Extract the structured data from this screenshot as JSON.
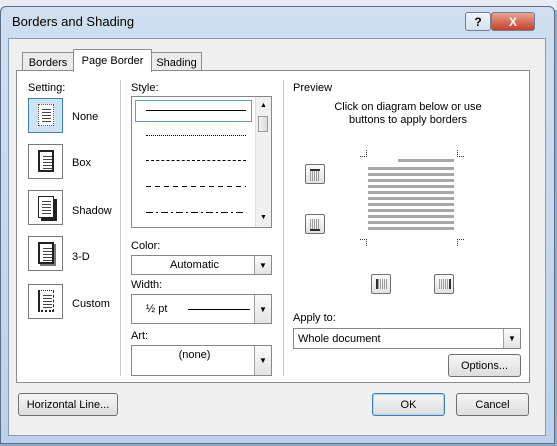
{
  "window": {
    "title": "Borders and Shading",
    "help_glyph": "?",
    "close_glyph": "X"
  },
  "tabs": [
    {
      "label": "Borders",
      "active": false
    },
    {
      "label": "Page Border",
      "active": true
    },
    {
      "label": "Shading",
      "active": false
    }
  ],
  "setting": {
    "label": "Setting:",
    "options": [
      {
        "label": "None",
        "icon": "setting-none-icon",
        "selected": true
      },
      {
        "label": "Box",
        "icon": "setting-box-icon",
        "selected": false
      },
      {
        "label": "Shadow",
        "icon": "setting-shadow-icon",
        "selected": false
      },
      {
        "label": "3-D",
        "icon": "setting-3d-icon",
        "selected": false
      },
      {
        "label": "Custom",
        "icon": "setting-custom-icon",
        "selected": false
      }
    ]
  },
  "style": {
    "label": "Style:",
    "items": [
      "solid",
      "dotted",
      "dashed-small",
      "dashed-large",
      "dash-dot"
    ],
    "selected": "solid"
  },
  "color": {
    "label": "Color:",
    "value": "Automatic"
  },
  "width": {
    "label": "Width:",
    "value": "½ pt"
  },
  "art": {
    "label": "Art:",
    "value": "(none)"
  },
  "preview": {
    "label": "Preview",
    "hint_line1": "Click on diagram below or use",
    "hint_line2": "buttons to apply borders"
  },
  "apply_to": {
    "label": "Apply to:",
    "value": "Whole document"
  },
  "buttons": {
    "options": "Options...",
    "horizontal_line": "Horizontal Line...",
    "ok": "OK",
    "cancel": "Cancel"
  },
  "colors": {
    "title_bg": "#c9dbee",
    "close": "#c7402a",
    "selection": "#cde4f7"
  }
}
